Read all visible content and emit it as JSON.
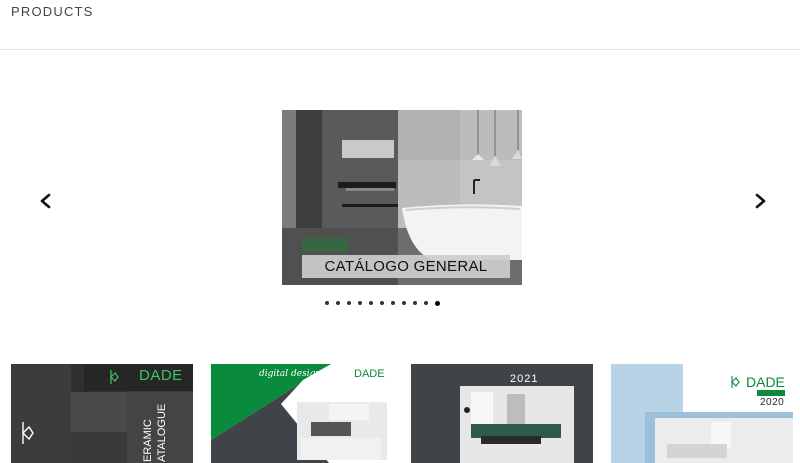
{
  "header": {
    "title": "PRODUCTS"
  },
  "carousel": {
    "prev_icon": "chevron-left-icon",
    "next_icon": "chevron-right-icon",
    "slide_caption": "CATÁLOGO GENERAL",
    "dot_count": 11,
    "active_dot": 11
  },
  "thumbnails": [
    {
      "brand": "DADE",
      "side_text_1": "ERAMIC",
      "side_text_2": "ATALOGUE"
    },
    {
      "script_text": "digital design",
      "brand": "DADE"
    },
    {
      "year": "2021"
    },
    {
      "brand": "DADE",
      "year": "2020"
    }
  ],
  "colors": {
    "brand_green": "#0a8a3c",
    "dark_panel": "#3f4449",
    "light_blue": "#b9d3e6"
  }
}
